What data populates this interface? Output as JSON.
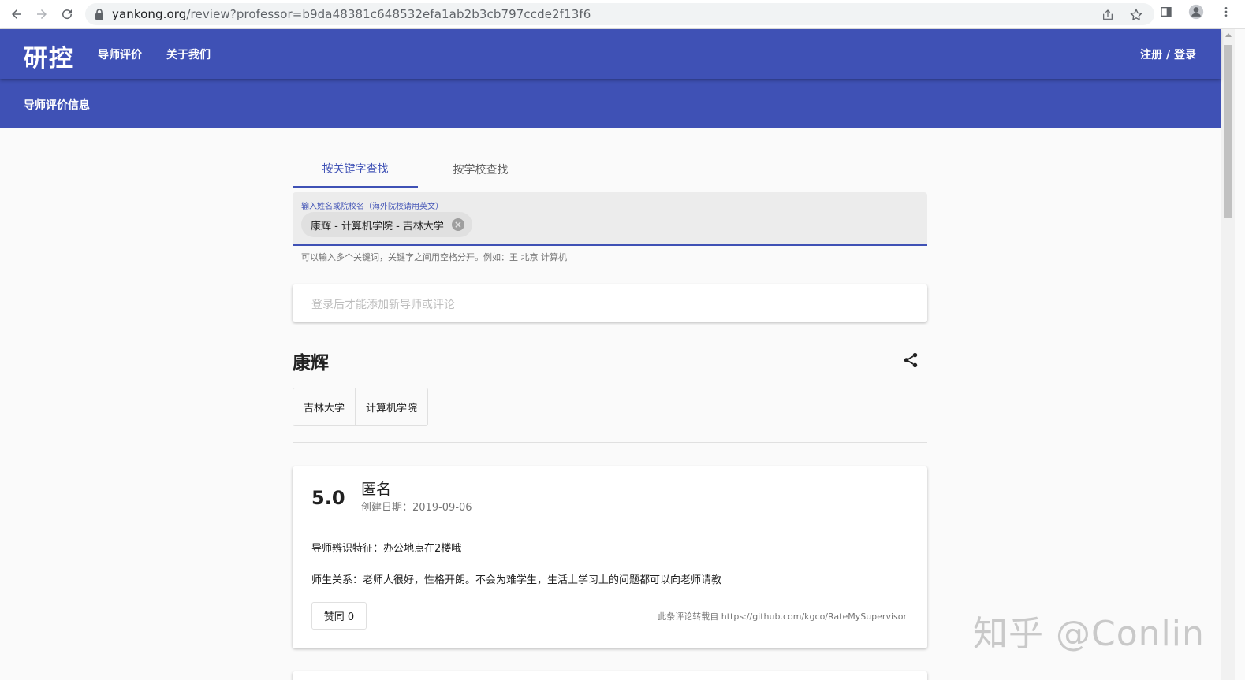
{
  "browser": {
    "url_host": "yankong.org",
    "url_path": "/review?professor=b9da48381c648532efa1ab2b3cb797ccde2f13f6"
  },
  "header": {
    "logo": "研控",
    "nav": [
      "导师评价",
      "关于我们"
    ],
    "login": "注册 / 登录",
    "subtitle": "导师评价信息"
  },
  "search": {
    "tabs": [
      "按关键字查找",
      "按学校查找"
    ],
    "active_tab": 0,
    "label": "输入姓名或院校名（海外院校请用英文）",
    "chip": "康辉 - 计算机学院 - 吉林大学",
    "helper": "可以输入多个关键词，关键字之间用空格分开。例如：王 北京 计算机"
  },
  "login_prompt": "登录后才能添加新导师或评论",
  "professor": {
    "name": "康辉",
    "tags": [
      "吉林大学",
      "计算机学院"
    ]
  },
  "reviews": [
    {
      "score": "5.0",
      "reviewer": "匿名",
      "created": "创建日期：2019-09-06",
      "line1": "导师辨识特征：办公地点在2楼哦",
      "line2": "师生关系：老师人很好，性格开朗。不会为难学生，生活上学习上的问题都可以向老师请教",
      "agree": "赞同 0",
      "source": "此条评论转载自 https://github.com/kgco/RateMySupervisor"
    }
  ],
  "watermark": "知乎 @Conlin",
  "colors": {
    "primary": "#3f51b5",
    "background": "#fafafa"
  }
}
